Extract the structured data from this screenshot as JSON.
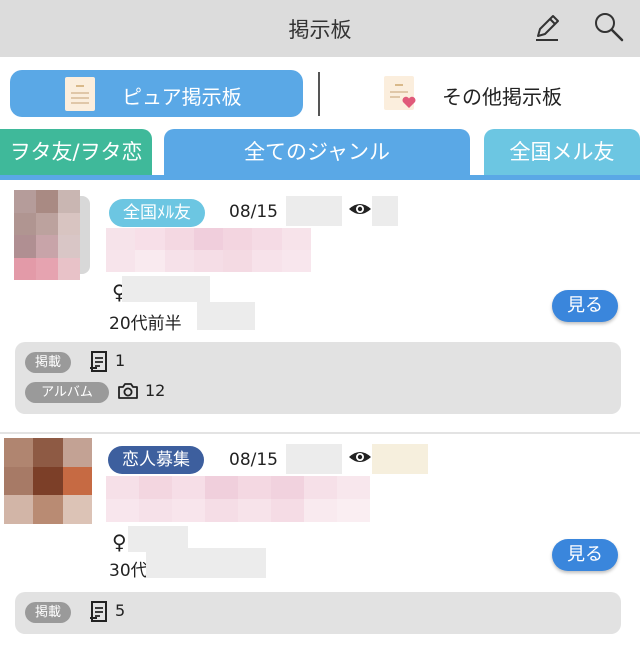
{
  "header": {
    "title": "掲示板",
    "icons": [
      "pencil-icon",
      "search-icon"
    ]
  },
  "board_switch": {
    "pure_label": "ピュア掲示板",
    "other_label": "その他掲示板"
  },
  "genre_tabs": [
    {
      "label": "ヲタ友/ヲタ恋",
      "color": "#3fb99a"
    },
    {
      "label": "全てのジャンル",
      "color": "#5aa8e6",
      "selected": true
    },
    {
      "label": "全国メル友",
      "color": "#6cc6e2"
    }
  ],
  "posts": [
    {
      "category": "全国ﾒﾙ友",
      "category_color": "#6cc6e2",
      "date": "08/15",
      "gender_symbol": "♀",
      "age": "20代前半",
      "view_button": "見る",
      "stats": [
        {
          "tag": "掲載",
          "icon": "document-icon",
          "count": "1"
        },
        {
          "tag": "アルバム",
          "icon": "camera-icon",
          "count": "12"
        }
      ]
    },
    {
      "category": "恋人募集",
      "category_color": "#3d5f9e",
      "date": "08/15",
      "gender_symbol": "♀",
      "age": "30代",
      "view_button": "見る",
      "stats": [
        {
          "tag": "掲載",
          "icon": "document-icon",
          "count": "5"
        }
      ]
    }
  ]
}
